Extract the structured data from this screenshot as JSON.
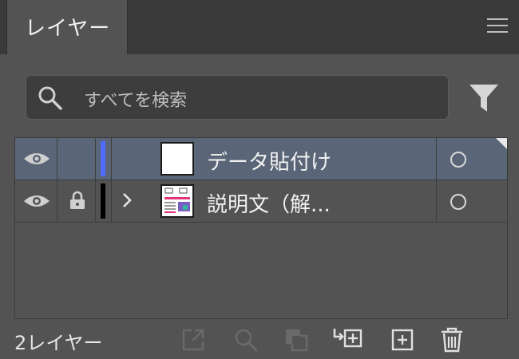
{
  "tab": {
    "label": "レイヤー"
  },
  "search": {
    "placeholder": "すべてを検索"
  },
  "layers": [
    {
      "name": "データ貼付け",
      "visible": true,
      "locked": false,
      "color": "#4f6bff",
      "expandable": false,
      "selected": true
    },
    {
      "name": "説明文（解...",
      "visible": true,
      "locked": true,
      "color": "#000000",
      "expandable": true,
      "selected": false
    }
  ],
  "footer": {
    "count_label": "2レイヤー"
  },
  "icons": {
    "menu": "hamburger-menu-icon",
    "search": "search-icon",
    "filter": "filter-icon",
    "eye": "eye-icon",
    "lock": "lock-icon",
    "chevron": "chevron-right-icon",
    "export": "export-icon",
    "find": "locate-object-icon",
    "mask": "clipping-mask-icon",
    "sublayer": "new-sublayer-icon",
    "newlayer": "new-layer-icon",
    "delete": "trash-icon"
  }
}
